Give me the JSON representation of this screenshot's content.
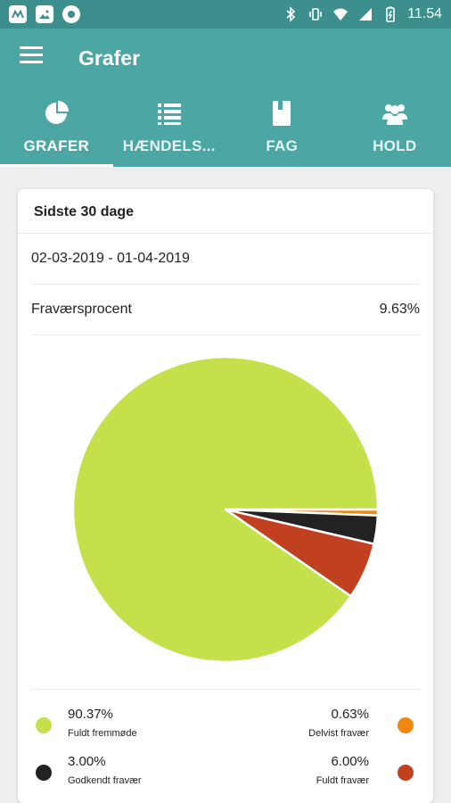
{
  "status_bar": {
    "time": "11.54"
  },
  "app_bar": {
    "title": "Grafer"
  },
  "tabs": [
    {
      "label": "GRAFER",
      "icon": "pie-chart-icon",
      "active": true
    },
    {
      "label": "HÆNDELS...",
      "icon": "list-icon",
      "active": false
    },
    {
      "label": "FAG",
      "icon": "book-icon",
      "active": false
    },
    {
      "label": "HOLD",
      "icon": "group-icon",
      "active": false
    }
  ],
  "card": {
    "title": "Sidste 30 dage",
    "date_range": "02-03-2019 - 01-04-2019",
    "absence_label": "Fraværsprocent",
    "absence_value": "9.63%"
  },
  "legend": [
    {
      "percent": "90.37%",
      "label": "Fuldt fremmøde",
      "color": "#c4e04a"
    },
    {
      "percent": "0.63%",
      "label": "Delvist fravær",
      "color": "#f2870f"
    },
    {
      "percent": "3.00%",
      "label": "Godkendt fravær",
      "color": "#222222"
    },
    {
      "percent": "6.00%",
      "label": "Fuldt fravær",
      "color": "#c0401f"
    }
  ],
  "chart_data": {
    "type": "pie",
    "slices": [
      {
        "name": "Delvist fravær",
        "value": 0.63,
        "color": "#f2870f"
      },
      {
        "name": "Godkendt fravær",
        "value": 3.0,
        "color": "#222222"
      },
      {
        "name": "Fuldt fravær",
        "value": 6.0,
        "color": "#c0401f"
      },
      {
        "name": "Fuldt fremmøde",
        "value": 90.37,
        "color": "#c4e04a"
      }
    ]
  }
}
